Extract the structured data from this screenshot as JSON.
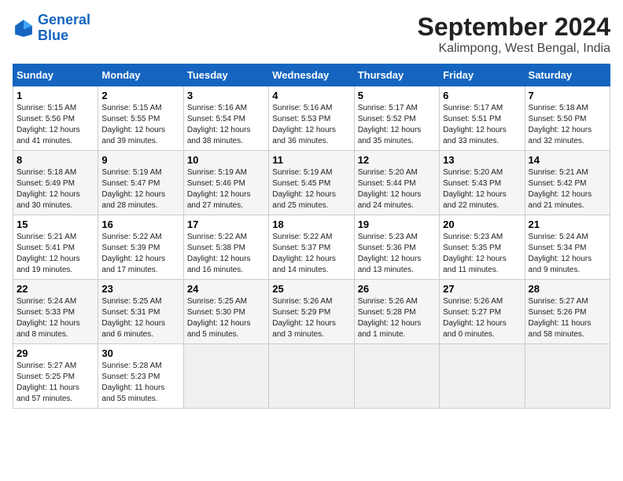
{
  "logo": {
    "line1": "General",
    "line2": "Blue"
  },
  "title": "September 2024",
  "subtitle": "Kalimpong, West Bengal, India",
  "headers": [
    "Sunday",
    "Monday",
    "Tuesday",
    "Wednesday",
    "Thursday",
    "Friday",
    "Saturday"
  ],
  "weeks": [
    [
      {
        "day": "1",
        "info": "Sunrise: 5:15 AM\nSunset: 5:56 PM\nDaylight: 12 hours\nand 41 minutes."
      },
      {
        "day": "2",
        "info": "Sunrise: 5:15 AM\nSunset: 5:55 PM\nDaylight: 12 hours\nand 39 minutes."
      },
      {
        "day": "3",
        "info": "Sunrise: 5:16 AM\nSunset: 5:54 PM\nDaylight: 12 hours\nand 38 minutes."
      },
      {
        "day": "4",
        "info": "Sunrise: 5:16 AM\nSunset: 5:53 PM\nDaylight: 12 hours\nand 36 minutes."
      },
      {
        "day": "5",
        "info": "Sunrise: 5:17 AM\nSunset: 5:52 PM\nDaylight: 12 hours\nand 35 minutes."
      },
      {
        "day": "6",
        "info": "Sunrise: 5:17 AM\nSunset: 5:51 PM\nDaylight: 12 hours\nand 33 minutes."
      },
      {
        "day": "7",
        "info": "Sunrise: 5:18 AM\nSunset: 5:50 PM\nDaylight: 12 hours\nand 32 minutes."
      }
    ],
    [
      {
        "day": "8",
        "info": "Sunrise: 5:18 AM\nSunset: 5:49 PM\nDaylight: 12 hours\nand 30 minutes."
      },
      {
        "day": "9",
        "info": "Sunrise: 5:19 AM\nSunset: 5:47 PM\nDaylight: 12 hours\nand 28 minutes."
      },
      {
        "day": "10",
        "info": "Sunrise: 5:19 AM\nSunset: 5:46 PM\nDaylight: 12 hours\nand 27 minutes."
      },
      {
        "day": "11",
        "info": "Sunrise: 5:19 AM\nSunset: 5:45 PM\nDaylight: 12 hours\nand 25 minutes."
      },
      {
        "day": "12",
        "info": "Sunrise: 5:20 AM\nSunset: 5:44 PM\nDaylight: 12 hours\nand 24 minutes."
      },
      {
        "day": "13",
        "info": "Sunrise: 5:20 AM\nSunset: 5:43 PM\nDaylight: 12 hours\nand 22 minutes."
      },
      {
        "day": "14",
        "info": "Sunrise: 5:21 AM\nSunset: 5:42 PM\nDaylight: 12 hours\nand 21 minutes."
      }
    ],
    [
      {
        "day": "15",
        "info": "Sunrise: 5:21 AM\nSunset: 5:41 PM\nDaylight: 12 hours\nand 19 minutes."
      },
      {
        "day": "16",
        "info": "Sunrise: 5:22 AM\nSunset: 5:39 PM\nDaylight: 12 hours\nand 17 minutes."
      },
      {
        "day": "17",
        "info": "Sunrise: 5:22 AM\nSunset: 5:38 PM\nDaylight: 12 hours\nand 16 minutes."
      },
      {
        "day": "18",
        "info": "Sunrise: 5:22 AM\nSunset: 5:37 PM\nDaylight: 12 hours\nand 14 minutes."
      },
      {
        "day": "19",
        "info": "Sunrise: 5:23 AM\nSunset: 5:36 PM\nDaylight: 12 hours\nand 13 minutes."
      },
      {
        "day": "20",
        "info": "Sunrise: 5:23 AM\nSunset: 5:35 PM\nDaylight: 12 hours\nand 11 minutes."
      },
      {
        "day": "21",
        "info": "Sunrise: 5:24 AM\nSunset: 5:34 PM\nDaylight: 12 hours\nand 9 minutes."
      }
    ],
    [
      {
        "day": "22",
        "info": "Sunrise: 5:24 AM\nSunset: 5:33 PM\nDaylight: 12 hours\nand 8 minutes."
      },
      {
        "day": "23",
        "info": "Sunrise: 5:25 AM\nSunset: 5:31 PM\nDaylight: 12 hours\nand 6 minutes."
      },
      {
        "day": "24",
        "info": "Sunrise: 5:25 AM\nSunset: 5:30 PM\nDaylight: 12 hours\nand 5 minutes."
      },
      {
        "day": "25",
        "info": "Sunrise: 5:26 AM\nSunset: 5:29 PM\nDaylight: 12 hours\nand 3 minutes."
      },
      {
        "day": "26",
        "info": "Sunrise: 5:26 AM\nSunset: 5:28 PM\nDaylight: 12 hours\nand 1 minute."
      },
      {
        "day": "27",
        "info": "Sunrise: 5:26 AM\nSunset: 5:27 PM\nDaylight: 12 hours\nand 0 minutes."
      },
      {
        "day": "28",
        "info": "Sunrise: 5:27 AM\nSunset: 5:26 PM\nDaylight: 11 hours\nand 58 minutes."
      }
    ],
    [
      {
        "day": "29",
        "info": "Sunrise: 5:27 AM\nSunset: 5:25 PM\nDaylight: 11 hours\nand 57 minutes."
      },
      {
        "day": "30",
        "info": "Sunrise: 5:28 AM\nSunset: 5:23 PM\nDaylight: 11 hours\nand 55 minutes."
      },
      null,
      null,
      null,
      null,
      null
    ]
  ]
}
